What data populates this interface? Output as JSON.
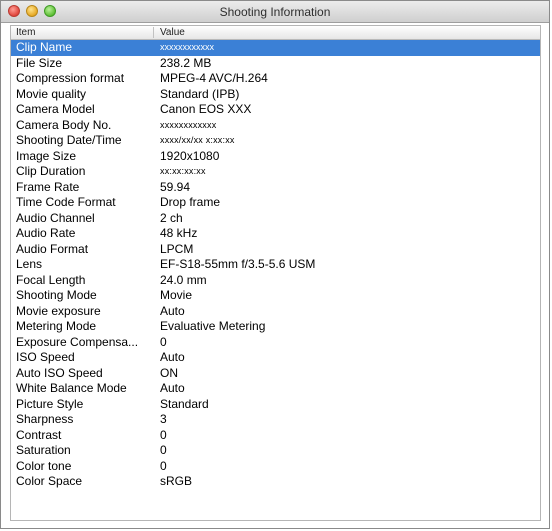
{
  "window": {
    "title": "Shooting Information"
  },
  "table": {
    "headers": {
      "item": "Item",
      "value": "Value"
    },
    "rows": [
      {
        "item": "Clip Name",
        "value": "xxxxxxxxxxxx",
        "selected": true
      },
      {
        "item": "File Size",
        "value": "238.2 MB"
      },
      {
        "item": "Compression format",
        "value": "MPEG-4 AVC/H.264"
      },
      {
        "item": "Movie quality",
        "value": "Standard (IPB)"
      },
      {
        "item": "Camera Model",
        "value": "Canon EOS XXX"
      },
      {
        "item": "Camera Body No.",
        "value": "xxxxxxxxxxxx",
        "small": true
      },
      {
        "item": "Shooting Date/Time",
        "value": "xxxx/xx/xx x:xx:xx",
        "small": true
      },
      {
        "item": "Image Size",
        "value": "1920x1080"
      },
      {
        "item": "Clip Duration",
        "value": "xx:xx:xx:xx",
        "small": true
      },
      {
        "item": "Frame Rate",
        "value": "59.94"
      },
      {
        "item": "Time Code Format",
        "value": "Drop frame"
      },
      {
        "item": "Audio Channel",
        "value": "2 ch"
      },
      {
        "item": "Audio Rate",
        "value": "48 kHz"
      },
      {
        "item": "Audio Format",
        "value": "LPCM"
      },
      {
        "item": "Lens",
        "value": "EF-S18-55mm f/3.5-5.6 USM"
      },
      {
        "item": "Focal Length",
        "value": "24.0 mm"
      },
      {
        "item": "Shooting Mode",
        "value": "Movie"
      },
      {
        "item": "Movie exposure",
        "value": "Auto"
      },
      {
        "item": "Metering Mode",
        "value": "Evaluative Metering"
      },
      {
        "item": "Exposure Compensa...",
        "value": "0"
      },
      {
        "item": "ISO Speed",
        "value": "Auto"
      },
      {
        "item": "Auto ISO Speed",
        "value": "ON"
      },
      {
        "item": "White Balance Mode",
        "value": "Auto"
      },
      {
        "item": "Picture Style",
        "value": "Standard"
      },
      {
        "item": "Sharpness",
        "value": "3"
      },
      {
        "item": "Contrast",
        "value": "0"
      },
      {
        "item": "Saturation",
        "value": "0"
      },
      {
        "item": "Color tone",
        "value": "0"
      },
      {
        "item": "Color Space",
        "value": "sRGB"
      }
    ]
  },
  "colors": {
    "selection": "#3b80d6"
  }
}
